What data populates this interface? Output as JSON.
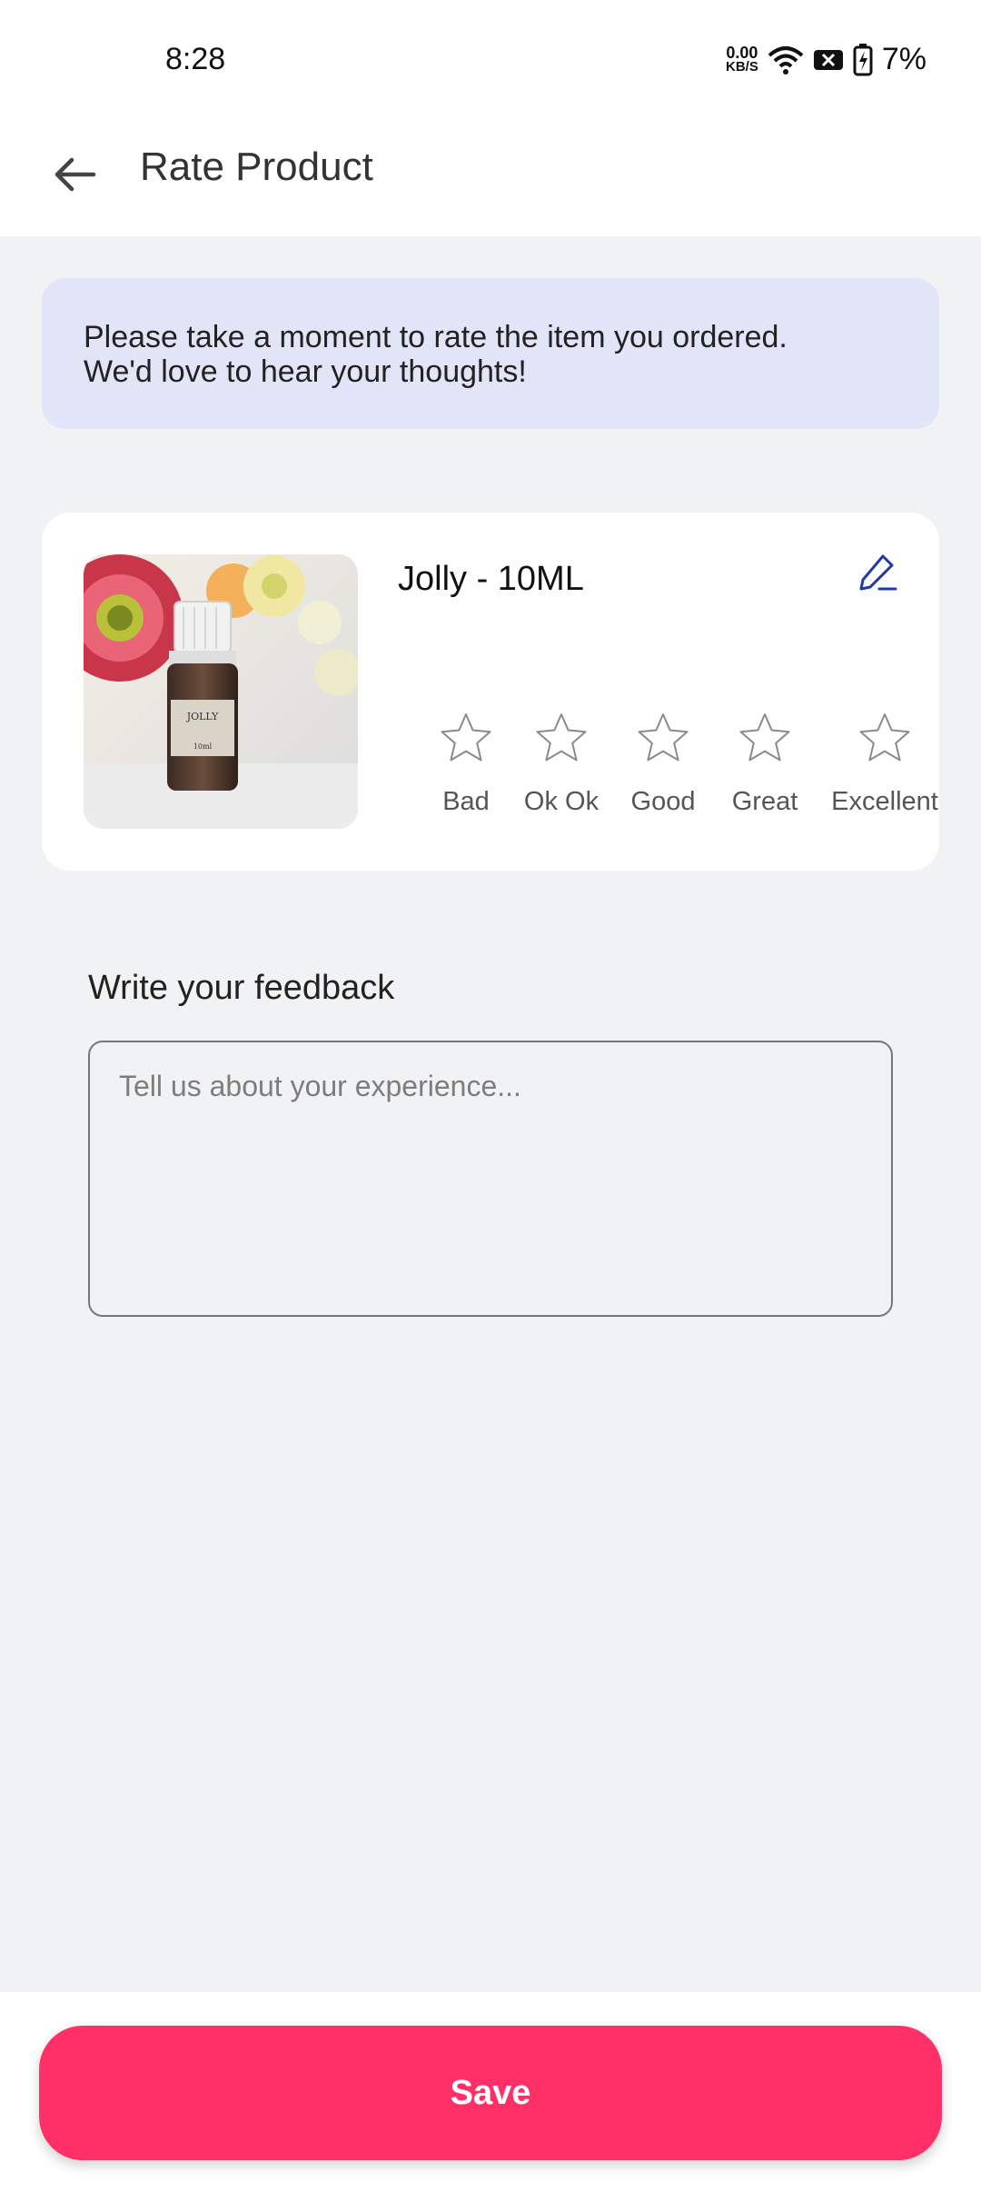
{
  "status_bar": {
    "time": "8:28",
    "net_speed_value": "0.00",
    "net_speed_unit": "KB/S",
    "battery": "7%"
  },
  "header": {
    "title": "Rate Product"
  },
  "banner": {
    "line1": "Please take a moment to rate the item you ordered.",
    "line2": "We'd love to hear your thoughts!"
  },
  "product": {
    "name": "Jolly - 10ML",
    "bottle_label": "JOLLY",
    "bottle_size": "10ml"
  },
  "ratings": [
    {
      "label": "Bad"
    },
    {
      "label": "Ok Ok"
    },
    {
      "label": "Good"
    },
    {
      "label": "Great"
    },
    {
      "label": "Excellent"
    }
  ],
  "feedback": {
    "label": "Write your feedback",
    "placeholder": "Tell us about your experience...",
    "value": ""
  },
  "actions": {
    "save_label": "Save"
  },
  "colors": {
    "accent": "#ff3068",
    "banner_bg": "#e2e5f7",
    "edit_icon": "#1f3aa8"
  }
}
